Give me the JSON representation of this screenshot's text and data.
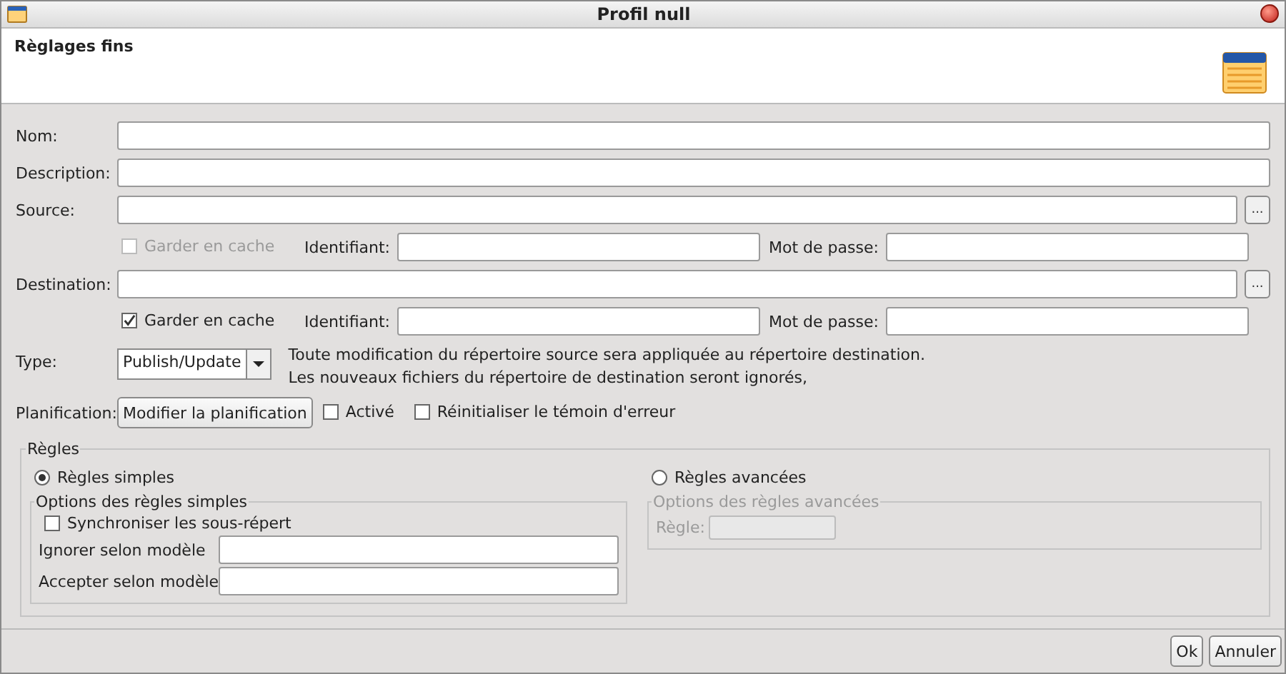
{
  "window": {
    "title": "Profil null"
  },
  "header": {
    "title": "Règlages fins"
  },
  "fields": [
    {
      "label": "Nom:"
    },
    {
      "label": "Description:"
    }
  ],
  "locations": [
    {
      "label": "Source:",
      "browse": "...",
      "cache": {
        "label": "Garder en cache",
        "checked": false,
        "disabled": true
      },
      "login_label": "Identifiant:",
      "password_label": "Mot de passe:"
    },
    {
      "label": "Destination:",
      "browse": "...",
      "cache": {
        "label": "Garder en cache",
        "checked": true,
        "disabled": false
      },
      "login_label": "Identifiant:",
      "password_label": "Mot de passe:"
    }
  ],
  "type": {
    "label": "Type:",
    "value": "Publish/Update",
    "description": [
      "Toute modification du répertoire source sera appliquée au répertoire destination.",
      "Les nouveaux fichiers du répertoire de destination seront ignorés,"
    ]
  },
  "schedule": {
    "label": "Planification:",
    "button": "Modifier la planification",
    "options": [
      {
        "label": "Activé",
        "checked": false
      },
      {
        "label": "Réinitialiser le témoin d'erreur",
        "checked": false
      }
    ]
  },
  "rules": {
    "title": "Règles",
    "simple": {
      "label": "Règles simples",
      "selected": true,
      "options_title": "Options des règles simples",
      "sync": {
        "label": "Synchroniser les sous-répert",
        "checked": false
      },
      "patterns": [
        {
          "label": "Ignorer selon modèle"
        },
        {
          "label": "Accepter selon modèle"
        }
      ]
    },
    "advanced": {
      "label": "Règles avancées",
      "selected": false,
      "options_title": "Options des règles avancées",
      "rule_label": "Règle:"
    }
  },
  "buttons": [
    "Ok",
    "Annuler"
  ]
}
